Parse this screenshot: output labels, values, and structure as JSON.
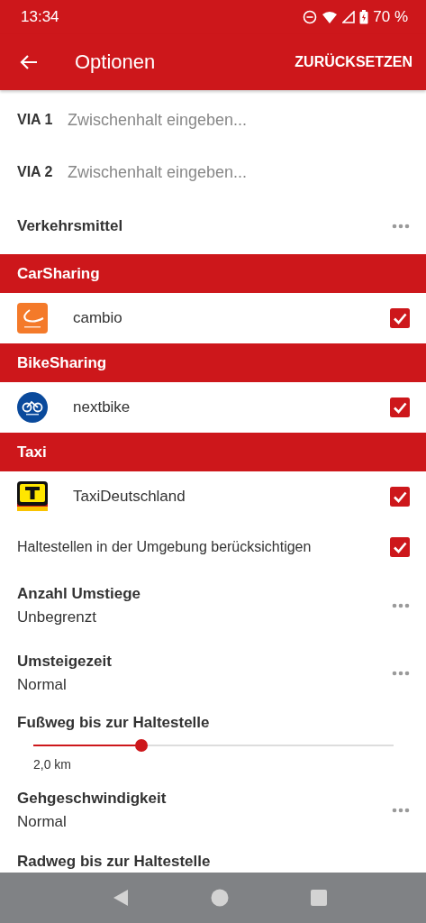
{
  "status_bar": {
    "time": "13:34",
    "battery": "70 %"
  },
  "app_bar": {
    "title": "Optionen",
    "action": "ZURÜCKSETZEN"
  },
  "items": [
    {
      "kind": "via",
      "label": "VIA 1",
      "placeholder": "Zwischenhalt eingeben..."
    },
    {
      "kind": "via",
      "label": "VIA 2",
      "placeholder": "Zwischenhalt eingeben..."
    },
    {
      "kind": "menu",
      "title": "Verkehrsmittel"
    },
    {
      "kind": "section",
      "title": "CarSharing"
    },
    {
      "kind": "provider",
      "name": "cambio",
      "checked": true,
      "color": "#f47a2a"
    },
    {
      "kind": "section",
      "title": "BikeSharing"
    },
    {
      "kind": "provider",
      "name": "nextbike",
      "checked": true,
      "color": "#0a4a9c"
    },
    {
      "kind": "section",
      "title": "Taxi"
    },
    {
      "kind": "provider",
      "name": "TaxiDeutschland",
      "checked": true,
      "color": "#ffe600"
    },
    {
      "kind": "check",
      "label": "Haltestellen in der Umgebung berücksichtigen",
      "checked": true
    },
    {
      "kind": "menu",
      "title": "Anzahl Umstiege",
      "value": "Unbegrenzt"
    },
    {
      "kind": "menu",
      "title": "Umsteigezeit",
      "value": "Normal"
    },
    {
      "kind": "slider",
      "title": "Fußweg bis zur Haltestelle",
      "level": 0.3,
      "reading": "2,0 km"
    },
    {
      "kind": "menu",
      "title": "Gehgeschwindigkeit",
      "value": "Normal"
    },
    {
      "kind": "heading",
      "title": "Radweg bis zur Haltestelle"
    }
  ]
}
